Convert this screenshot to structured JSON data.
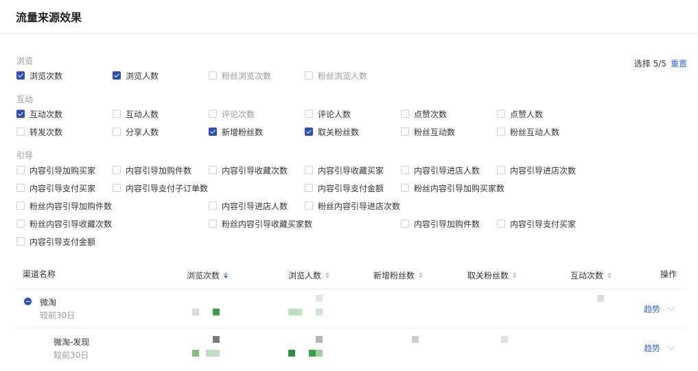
{
  "page": {
    "title": "流量来源效果"
  },
  "selection": {
    "label": "选择 5/5",
    "reset": "重置"
  },
  "groups": [
    {
      "label": "浏览",
      "items": [
        {
          "label": "浏览次数",
          "checked": true
        },
        {
          "label": "浏览人数",
          "checked": true
        },
        {
          "label": "粉丝浏览次数",
          "checked": false
        },
        {
          "label": "粉丝浏览人数",
          "checked": false
        }
      ]
    },
    {
      "label": "互动",
      "items": [
        {
          "label": "互动次数",
          "checked": true
        },
        {
          "label": "互动人数",
          "checked": false
        },
        {
          "label": "评论次数",
          "checked": false
        },
        {
          "label": "评论人数",
          "checked": false
        },
        {
          "label": "点赞次数",
          "checked": false
        },
        {
          "label": "点赞人数",
          "checked": false
        },
        {
          "label": "转发次数",
          "checked": false
        },
        {
          "label": "分享人数",
          "checked": false
        },
        {
          "label": "新增粉丝数",
          "checked": true
        },
        {
          "label": "取关粉丝数",
          "checked": true
        },
        {
          "label": "粉丝互动数",
          "checked": false
        },
        {
          "label": "粉丝互动人数",
          "checked": false
        }
      ]
    },
    {
      "label": "引导",
      "items": [
        {
          "label": "内容引导加购买家",
          "checked": false
        },
        {
          "label": "内容引导加购件数",
          "checked": false
        },
        {
          "label": "内容引导收藏次数",
          "checked": false
        },
        {
          "label": "内容引导收藏买家",
          "checked": false
        },
        {
          "label": "内容引导进店人数",
          "checked": false
        },
        {
          "label": "内容引导进店次数",
          "checked": false
        },
        {
          "label": "内容引导支付买家",
          "checked": false
        },
        {
          "label": "内容引导支付子订单数",
          "checked": false
        },
        {
          "label": "内容引导支付金额",
          "checked": false
        },
        {
          "label": "粉丝内容引导加购买家数",
          "checked": false
        },
        {
          "label": "粉丝内容引导加购件数",
          "checked": false
        },
        {
          "label": "内容引导进店人数",
          "checked": false
        },
        {
          "label": "粉丝内容引导进店次数",
          "checked": false
        },
        {
          "label": "粉丝内容引导收藏次数",
          "checked": false
        },
        {
          "label": "粉丝内容引导收藏买家数",
          "checked": false
        },
        {
          "label": "内容引导加购件数",
          "checked": false
        },
        {
          "label": "内容引导支付买家",
          "checked": false
        },
        {
          "label": "内容引导支付金额",
          "checked": false
        }
      ]
    }
  ],
  "table": {
    "columns": [
      "渠道名称",
      "浏览次数",
      "浏览人数",
      "新增粉丝数",
      "取关粉丝数",
      "互动次数",
      "操作"
    ],
    "rows": [
      {
        "name": "微淘",
        "sub": "较前30日",
        "action": "趋势"
      },
      {
        "name": "微淘-发现",
        "sub": "较前30日",
        "action": "趋势"
      }
    ]
  },
  "colors": {
    "accent": "#2e66e8",
    "checkbox": "#2b4fb5",
    "blur_green": "#3aa14a"
  }
}
